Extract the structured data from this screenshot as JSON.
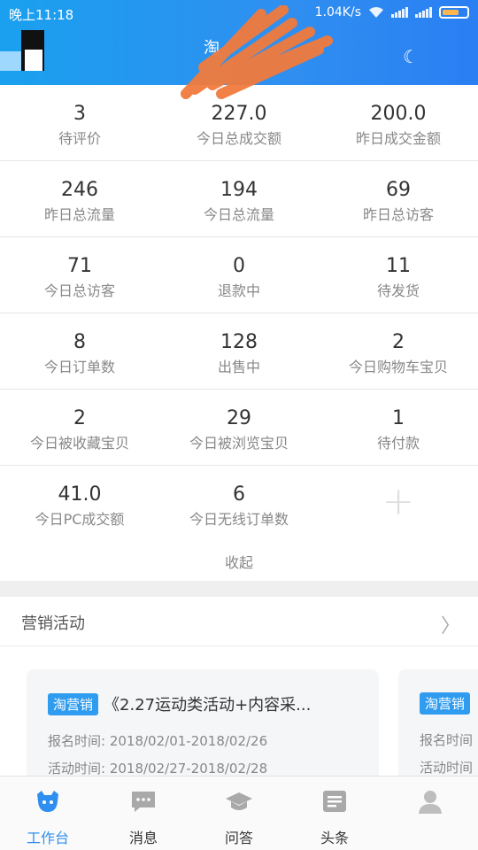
{
  "status_bar": {
    "time": "晚上11:18",
    "net_speed": "1.04K/s"
  },
  "header": {
    "shop_name": "淘",
    "colors": {
      "gradient_start": "#1aa0ef",
      "gradient_end": "#2a7ff3"
    }
  },
  "stats": {
    "rows": [
      [
        {
          "value": "3",
          "label": "待评价"
        },
        {
          "value": "227.0",
          "label": "今日总成交额"
        },
        {
          "value": "200.0",
          "label": "昨日成交金额"
        }
      ],
      [
        {
          "value": "246",
          "label": "昨日总流量"
        },
        {
          "value": "194",
          "label": "今日总流量"
        },
        {
          "value": "69",
          "label": "昨日总访客"
        }
      ],
      [
        {
          "value": "71",
          "label": "今日总访客"
        },
        {
          "value": "0",
          "label": "退款中"
        },
        {
          "value": "11",
          "label": "待发货"
        }
      ],
      [
        {
          "value": "8",
          "label": "今日订单数"
        },
        {
          "value": "128",
          "label": "出售中"
        },
        {
          "value": "2",
          "label": "今日购物车宝贝"
        }
      ],
      [
        {
          "value": "2",
          "label": "今日被收藏宝贝"
        },
        {
          "value": "29",
          "label": "今日被浏览宝贝"
        },
        {
          "value": "1",
          "label": "待付款"
        }
      ],
      [
        {
          "value": "41.0",
          "label": "今日PC成交额"
        },
        {
          "value": "6",
          "label": "今日无线订单数"
        }
      ]
    ],
    "add_icon": "plus-icon",
    "collapse_label": "收起"
  },
  "marketing": {
    "title": "营销活动",
    "cards": [
      {
        "tag": "淘营销",
        "title": "《2.27运动类活动+内容采...",
        "signup": "报名时间: 2018/02/01-2018/02/26",
        "activity": "活动时间: 2018/02/27-2018/02/28"
      },
      {
        "tag": "淘营销",
        "title": "",
        "signup": "报名时间",
        "activity": "活动时间"
      }
    ]
  },
  "tabbar": {
    "accent": "#2f8ff0",
    "tabs": [
      {
        "label": "工作台",
        "icon": "workbench-icon",
        "active": true
      },
      {
        "label": "消息",
        "icon": "message-icon",
        "active": false
      },
      {
        "label": "问答",
        "icon": "qa-cap-icon",
        "active": false
      },
      {
        "label": "头条",
        "icon": "headline-icon",
        "active": false
      },
      {
        "label": "",
        "icon": "profile-icon",
        "active": false
      }
    ]
  }
}
